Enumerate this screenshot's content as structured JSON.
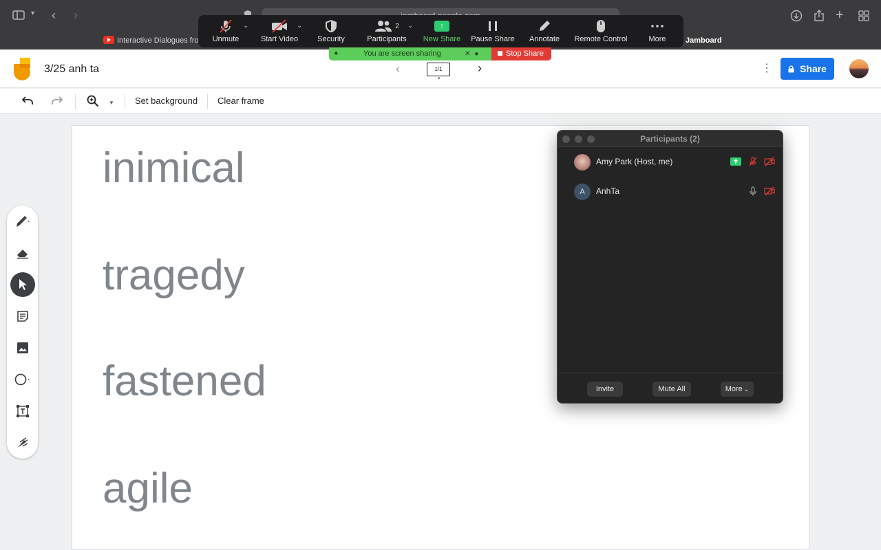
{
  "browser": {
    "url": "jamboard.google.com",
    "bookmarks": [
      {
        "label": "Interactive Dialogues from"
      },
      {
        "label": "Jamboard"
      }
    ]
  },
  "zoom_toolbar": {
    "unmute": "Unmute",
    "start_video": "Start Video",
    "security": "Security",
    "participants": "Participants",
    "participants_count": "2",
    "new_share": "New Share",
    "pause_share": "Pause Share",
    "annotate": "Annotate",
    "remote_control": "Remote Control",
    "more": "More"
  },
  "share_banner": {
    "status": "You are screen sharing",
    "stop": "Stop Share"
  },
  "jamboard": {
    "title": "3/25 anh ta",
    "frame_indicator": "1/1",
    "share_label": "Share",
    "toolbar": {
      "set_background": "Set background",
      "clear_frame": "Clear frame"
    },
    "words": [
      "inimical",
      "tragedy",
      "fastened",
      "agile"
    ]
  },
  "participants_panel": {
    "title": "Participants (2)",
    "members": [
      {
        "name": "Amy Park (Host, me)",
        "initial": ""
      },
      {
        "name": "AnhTa",
        "initial": "A"
      }
    ],
    "invite": "Invite",
    "mute_all": "Mute All",
    "more": "More"
  },
  "colors": {
    "zoom_green": "#5fd068",
    "stop_red": "#e23b35",
    "share_blue": "#1a73e8",
    "word_gray": "#80868b"
  }
}
